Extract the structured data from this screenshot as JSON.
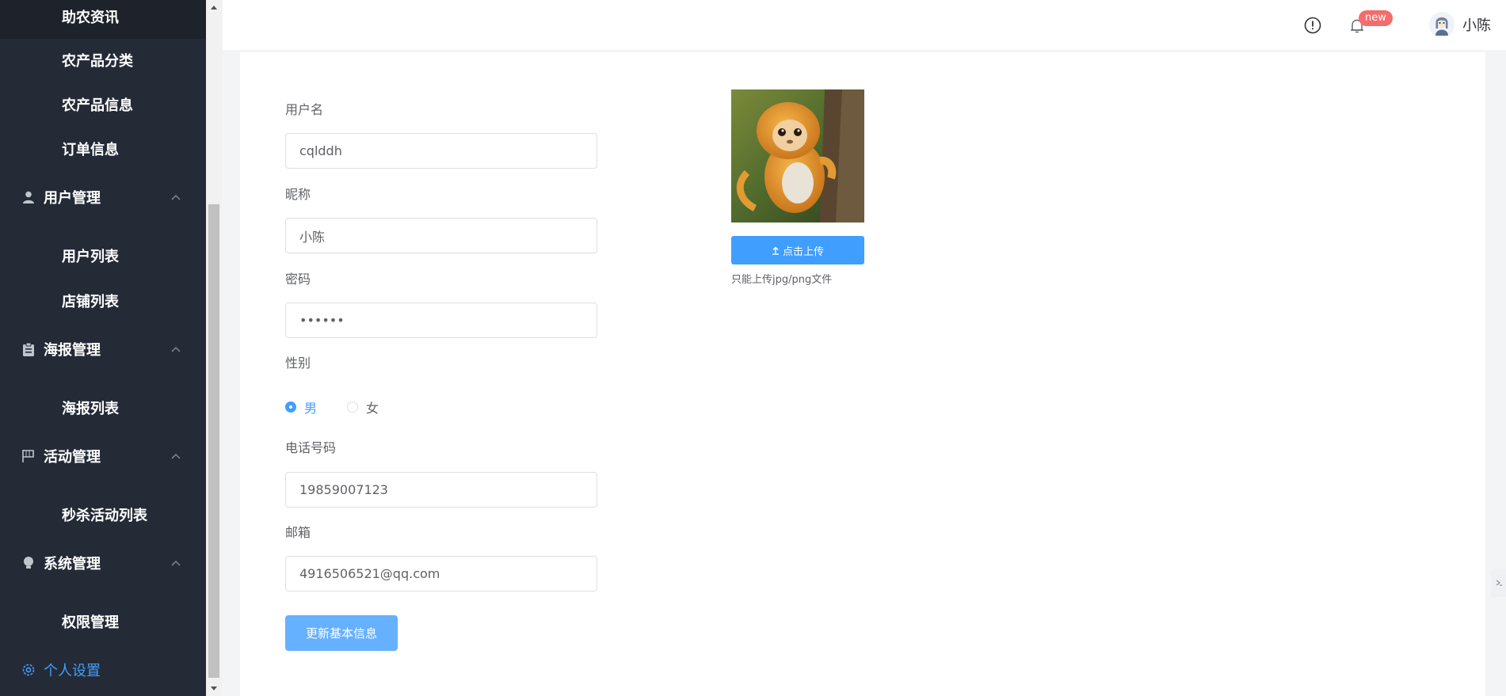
{
  "sidebar": {
    "items": [
      {
        "label": "助农资讯"
      },
      {
        "label": "农产品分类"
      },
      {
        "label": "农产品信息"
      },
      {
        "label": "订单信息"
      },
      {
        "label": "用户管理"
      },
      {
        "label": "用户列表"
      },
      {
        "label": "店铺列表"
      },
      {
        "label": "海报管理"
      },
      {
        "label": "海报列表"
      },
      {
        "label": "活动管理"
      },
      {
        "label": "秒杀活动列表"
      },
      {
        "label": "系统管理"
      },
      {
        "label": "权限管理"
      },
      {
        "label": "个人设置"
      }
    ]
  },
  "header": {
    "badge": "new",
    "username": "小陈",
    "icons": [
      "info-circle-icon",
      "bell-icon",
      "avatar"
    ]
  },
  "form": {
    "username_label": "用户名",
    "username_value": "cqlddh",
    "nickname_label": "昵称",
    "nickname_value": "小陈",
    "password_label": "密码",
    "password_value": "••••••",
    "gender_label": "性别",
    "gender_options": [
      "男",
      "女"
    ],
    "gender_selected": "男",
    "phone_label": "电话号码",
    "phone_value": "19859007123",
    "email_label": "邮箱",
    "email_value": "4916506521@qq.com",
    "submit_label": "更新基本信息"
  },
  "upload": {
    "button_label": "点击上传",
    "tip": "只能上传jpg/png文件"
  },
  "colors": {
    "sidebar_bg": "#242b37",
    "accent": "#409eff",
    "badge": "#f56c6c"
  }
}
